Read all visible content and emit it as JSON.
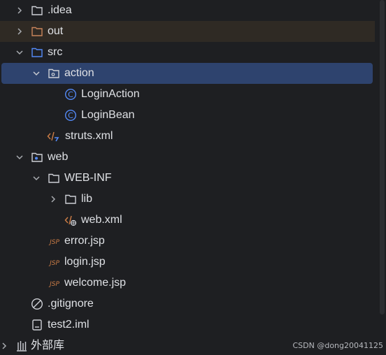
{
  "tree": {
    "items": [
      {
        "label": ".idea"
      },
      {
        "label": "out"
      },
      {
        "label": "src"
      },
      {
        "label": "action"
      },
      {
        "label": "LoginAction"
      },
      {
        "label": "LoginBean"
      },
      {
        "label": "struts.xml"
      },
      {
        "label": "web"
      },
      {
        "label": "WEB-INF"
      },
      {
        "label": "lib"
      },
      {
        "label": "web.xml"
      },
      {
        "label": "error.jsp"
      },
      {
        "label": "login.jsp"
      },
      {
        "label": "welcome.jsp"
      },
      {
        "label": ".gitignore"
      },
      {
        "label": "test2.iml"
      }
    ],
    "external_libraries": "外部库",
    "class_glyph": "C",
    "jsp_glyph": "JSP"
  },
  "watermark": "CSDN @dong20041125",
  "colors": {
    "background": "#1e1f22",
    "selection": "#2e436e",
    "out_row": "#2f2a24",
    "folder_gray": "#ced0d6",
    "folder_orange": "#c9845b",
    "folder_blue": "#548af7",
    "class_blue": "#548af7",
    "jsp_orange": "#c97b45"
  }
}
